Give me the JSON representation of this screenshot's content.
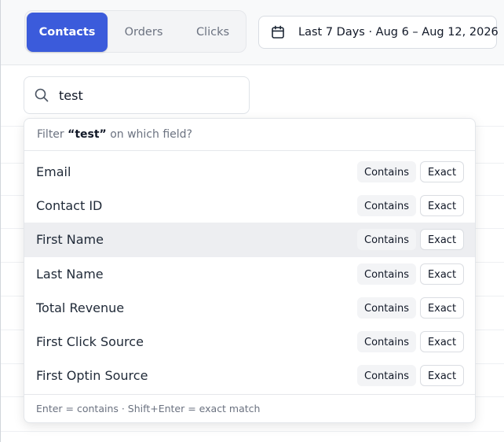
{
  "tabs": [
    {
      "label": "Contacts",
      "active": true
    },
    {
      "label": "Orders",
      "active": false
    },
    {
      "label": "Clicks",
      "active": false
    }
  ],
  "date_range": {
    "icon": "calendar-icon",
    "label": "Last 7 Days · Aug 6 – Aug 12, 2026"
  },
  "search": {
    "icon": "search-icon",
    "value": "test"
  },
  "filter_menu": {
    "header_prefix": "Filter",
    "header_query": "“test”",
    "header_suffix": "on which field?",
    "contains_label": "Contains",
    "exact_label": "Exact",
    "fields": [
      {
        "label": "Email",
        "highlighted": false
      },
      {
        "label": "Contact ID",
        "highlighted": false
      },
      {
        "label": "First Name",
        "highlighted": true
      },
      {
        "label": "Last Name",
        "highlighted": false
      },
      {
        "label": "Total Revenue",
        "highlighted": false
      },
      {
        "label": "First Click Source",
        "highlighted": false
      },
      {
        "label": "First Optin Source",
        "highlighted": false
      }
    ],
    "footer_hint": "Enter = contains · Shift+Enter = exact match"
  },
  "colors": {
    "accent": "#3b5bdb",
    "highlight_row": "#edeef1",
    "muted_text": "#6b7280"
  }
}
